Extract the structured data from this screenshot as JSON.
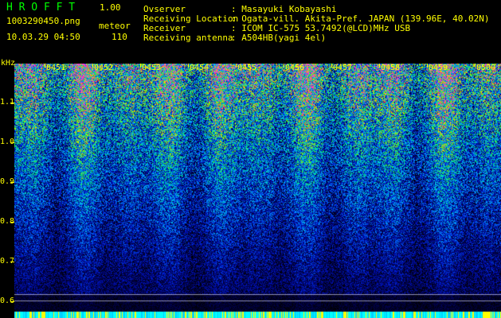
{
  "app": {
    "title": "H R O F F T",
    "version": "1.00",
    "filename": "1003290450.png",
    "mode": "meteor",
    "datetime": "10.03.29 04:50",
    "count": "110"
  },
  "info": [
    {
      "key": "Ovserver",
      "value": ": Masayuki Kobayashi"
    },
    {
      "key": "Receiving Location",
      "value": ": Ogata-vill. Akita-Pref. JAPAN (139.96E, 40.02N)"
    },
    {
      "key": "Receiver",
      "value": ": ICOM IC-575 53.7492(@LCD)MHz USB"
    },
    {
      "key": "Receiving antenna",
      "value": ": A504HB(yagi 4el)"
    }
  ],
  "axis": {
    "unit": "kHz",
    "y_ticks": [
      "1.1",
      "1.0",
      "0.9",
      "0.8",
      "0.7",
      "0.6"
    ],
    "x_ticks": [
      "0451",
      "0452",
      "0453",
      "0454",
      "0455",
      "0456",
      "0457",
      "0458",
      "0459",
      "0500"
    ]
  },
  "colors": {
    "text": "#ffff00",
    "background": "#000000"
  }
}
